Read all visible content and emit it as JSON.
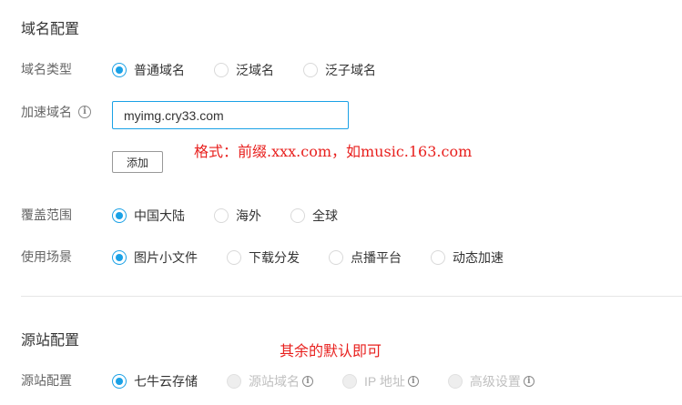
{
  "domain_config": {
    "title": "域名配置",
    "domain_type": {
      "label": "域名类型",
      "options": [
        {
          "label": "普通域名",
          "checked": true
        },
        {
          "label": "泛域名",
          "checked": false
        },
        {
          "label": "泛子域名",
          "checked": false
        }
      ]
    },
    "accel_domain": {
      "label": "加速域名",
      "value": "myimg.cry33.com",
      "add_label": "添加"
    },
    "coverage": {
      "label": "覆盖范围",
      "options": [
        {
          "label": "中国大陆",
          "checked": true
        },
        {
          "label": "海外",
          "checked": false
        },
        {
          "label": "全球",
          "checked": false
        }
      ]
    },
    "scenario": {
      "label": "使用场景",
      "options": [
        {
          "label": "图片小文件",
          "checked": true
        },
        {
          "label": "下载分发",
          "checked": false
        },
        {
          "label": "点播平台",
          "checked": false
        },
        {
          "label": "动态加速",
          "checked": false
        }
      ]
    }
  },
  "origin_config": {
    "title": "源站配置",
    "origin": {
      "label": "源站配置",
      "options": [
        {
          "label": "七牛云存储",
          "checked": true,
          "disabled": false
        },
        {
          "label": "源站域名",
          "checked": false,
          "disabled": true,
          "info": true
        },
        {
          "label": "IP 地址",
          "checked": false,
          "disabled": true,
          "info": true
        },
        {
          "label": "高级设置",
          "checked": false,
          "disabled": true,
          "info": true
        }
      ]
    }
  },
  "annotations": {
    "format_note": "格式：前缀.xxx.com，如music.163.com",
    "default_note": "其余的默认即可"
  },
  "colors": {
    "accent": "#1aa1e6",
    "annotation": "#e8201e"
  },
  "icons": {
    "info": "info-circle-icon"
  }
}
